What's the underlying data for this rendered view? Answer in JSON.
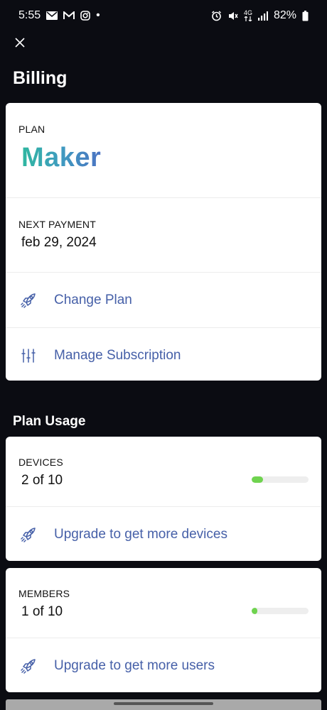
{
  "status": {
    "time": "5:55",
    "dot": "•",
    "battery": "82%",
    "network": "4G"
  },
  "header": {
    "title": "Billing"
  },
  "plan_card": {
    "plan_label": "PLAN",
    "plan_name": "Maker",
    "next_payment_label": "NEXT PAYMENT",
    "next_payment_value": "feb 29, 2024",
    "change_plan": "Change Plan",
    "manage_subscription": "Manage Subscription"
  },
  "usage": {
    "title": "Plan Usage",
    "devices": {
      "label": "DEVICES",
      "value": "2 of 10",
      "progress": 0.2,
      "upgrade": "Upgrade to get more devices"
    },
    "members": {
      "label": "MEMBERS",
      "value": "1 of 10",
      "progress": 0.1,
      "upgrade": "Upgrade to get more users"
    }
  },
  "colors": {
    "background": "#0b0c12",
    "link": "#4660a8",
    "progress_fill": "#6fd34f",
    "progress_track": "#eeeeee"
  },
  "icons": [
    "close-icon",
    "rocket-icon",
    "sliders-icon"
  ]
}
